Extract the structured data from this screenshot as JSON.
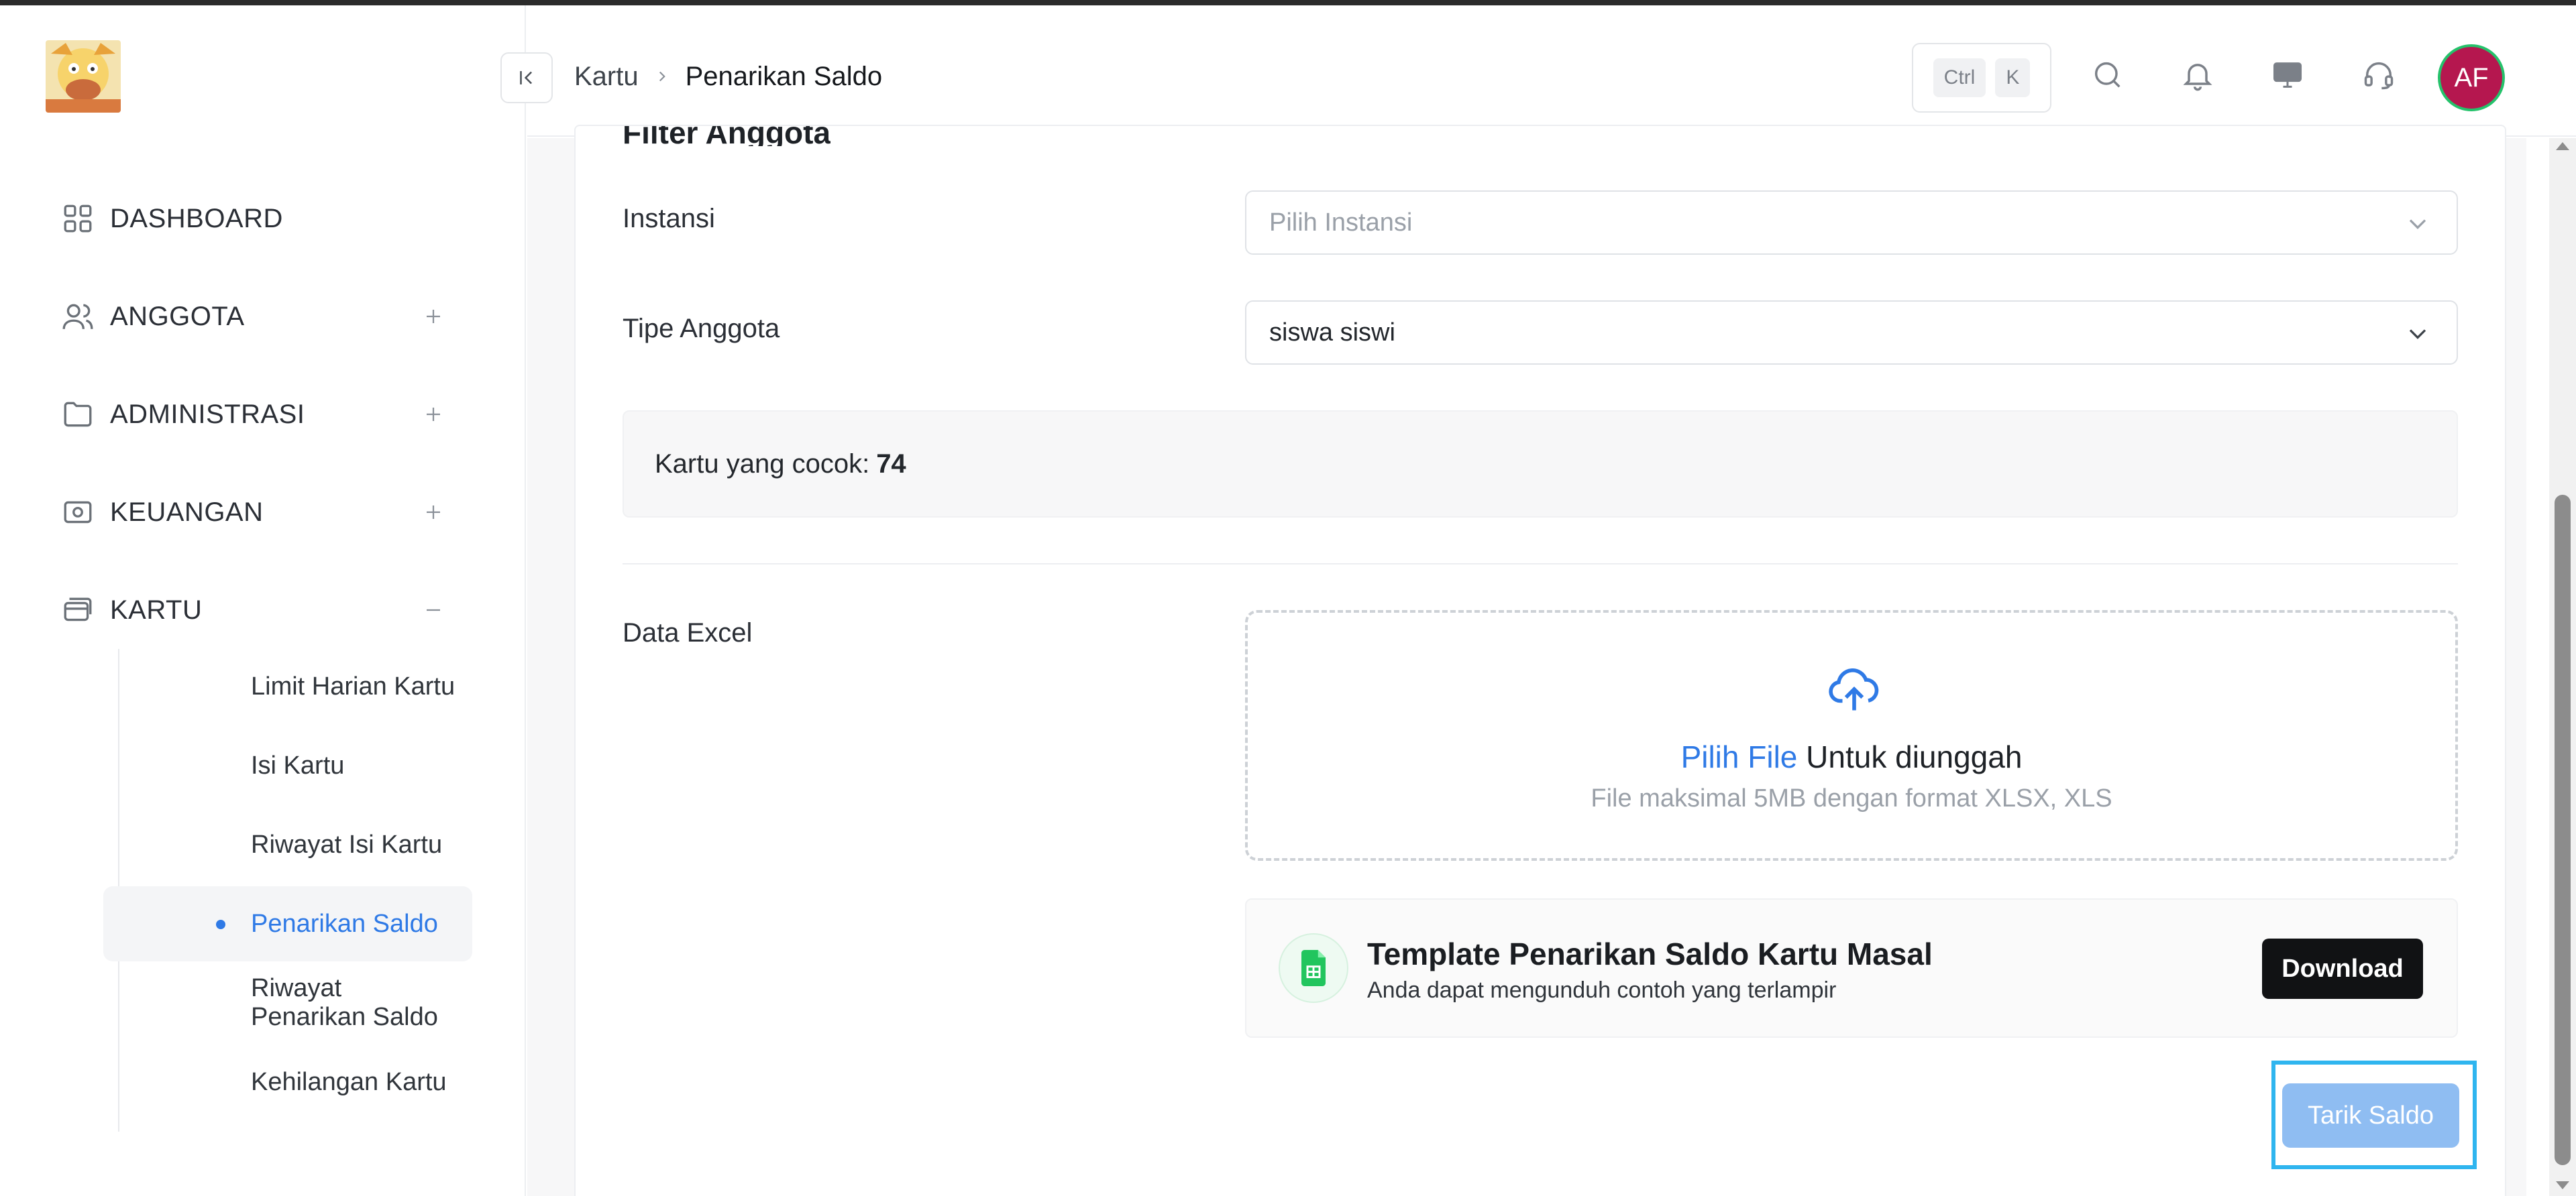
{
  "header": {
    "breadcrumb_root": "Kartu",
    "breadcrumb_current": "Penarikan Saldo",
    "shortcut_key1": "Ctrl",
    "shortcut_key2": "K",
    "avatar_initials": "AF"
  },
  "sidebar": {
    "items": [
      {
        "label": "DASHBOARD",
        "icon": "grid-icon"
      },
      {
        "label": "ANGGOTA",
        "icon": "users-icon",
        "toggle": "+"
      },
      {
        "label": "ADMINISTRASI",
        "icon": "folder-icon",
        "toggle": "+"
      },
      {
        "label": "KEUANGAN",
        "icon": "wallet-icon",
        "toggle": "+"
      },
      {
        "label": "KARTU",
        "icon": "card-icon",
        "toggle": "−"
      }
    ],
    "sub_items": [
      {
        "label": "Limit Harian Kartu"
      },
      {
        "label": "Isi Kartu"
      },
      {
        "label": "Riwayat Isi Kartu"
      },
      {
        "label": "Penarikan Saldo",
        "active": true
      },
      {
        "label": "Riwayat Penarikan Saldo"
      },
      {
        "label": "Kehilangan Kartu"
      }
    ]
  },
  "main": {
    "section_title": "Filter Anggota",
    "instansi_label": "Instansi",
    "instansi_placeholder": "Pilih Instansi",
    "tipe_label": "Tipe Anggota",
    "tipe_value": "siswa siswi",
    "match_text": "Kartu yang cocok:",
    "match_count": "74",
    "excel_label": "Data Excel",
    "upload_link": "Pilih File",
    "upload_text": "Untuk diunggah",
    "upload_hint": "File maksimal 5MB dengan format XLSX, XLS",
    "template_title": "Template Penarikan Saldo Kartu Masal",
    "template_sub": "Anda dapat mengunduh contoh yang terlampir",
    "download_label": "Download",
    "submit_label": "Tarik Saldo"
  },
  "colors": {
    "accent": "#2f7ae6",
    "avatar_bg": "#b5174f",
    "avatar_ring": "#25c26b",
    "submit_bg": "#8fbdf2",
    "focus_outline": "#2fb5ef"
  }
}
